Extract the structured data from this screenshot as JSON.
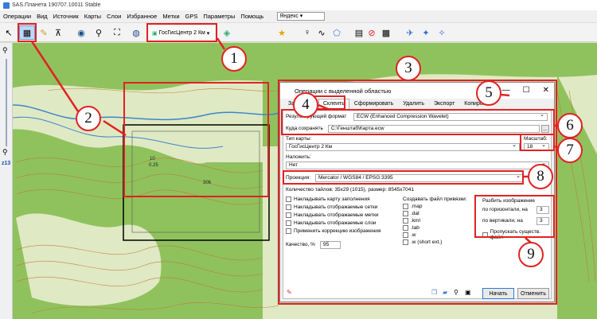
{
  "window": {
    "title": "SAS.Планета 190707.10011 Stable"
  },
  "menu": {
    "items": [
      "Операции",
      "Вид",
      "Источник",
      "Карты",
      "Слои",
      "Избранное",
      "Метки",
      "GPS",
      "Параметры",
      "Помощь"
    ],
    "search_engine": "Яндекс"
  },
  "toolbar": {
    "map_selector": "ГосГисЦентр 2 Км"
  },
  "left_panel": {
    "zoom_label": "z13"
  },
  "map_labels": {
    "point_a": "10",
    "point_b": "0.25",
    "point_c": "306"
  },
  "dialog": {
    "title": "Операции с выделенной областью",
    "tabs": [
      "Загрузить",
      "Склеить",
      "Сформировать",
      "Удалить",
      "Экспорт",
      "Копировать"
    ],
    "active_tab": "Склеить",
    "format_label": "Результирующий формат",
    "format_value": "ECW (Enhanced Compression Wavelet)",
    "save_label": "Куда сохранять",
    "save_value": "C:\\Генштаб\\Карта.ecw",
    "browse_label": "...",
    "map_type_label": "Тип карты:",
    "map_type_value": "ГосГисЦентр 2 Км",
    "scale_label": "Масштаб:",
    "scale_value": "18",
    "overlay_label": "Наложить:",
    "overlay_value": "Нет",
    "projection_label": "Проекция:",
    "projection_value": "Mercator / WGS84 / EPSG:3395",
    "tiles_info": "Количество тайлов: 35x29 (1015), размер: 8545x7041",
    "options": [
      "Накладывать карту заполнения",
      "Накладывать отображаемые сетки",
      "Накладывать отображаемые метки",
      "Накладывать отображаемые слои",
      "Применить коррекцию изображения"
    ],
    "quality_label": "Качество, %",
    "quality_value": "95",
    "binding_label": "Создавать файл привязки:",
    "binding_files": [
      ".map",
      ".dat",
      ".kml",
      ".tab",
      ".w",
      ".w (short ext.)"
    ],
    "split_label": "Разбить изображение",
    "split_h_label": "по горизонтали, на",
    "split_h_value": "3",
    "split_v_label": "по вертикали, на",
    "split_v_value": "3",
    "skip_label": "Пропускать существ. файл",
    "start_button": "Начать",
    "cancel_button": "Отменить"
  },
  "annotations": [
    "1",
    "2",
    "3",
    "4",
    "5",
    "6",
    "7",
    "8",
    "9"
  ],
  "colors": {
    "annotation": "#e02222",
    "map_green": "#8fc25d",
    "map_light": "#dfe9c3",
    "contour": "#c0763a",
    "river": "#3f86c9"
  }
}
